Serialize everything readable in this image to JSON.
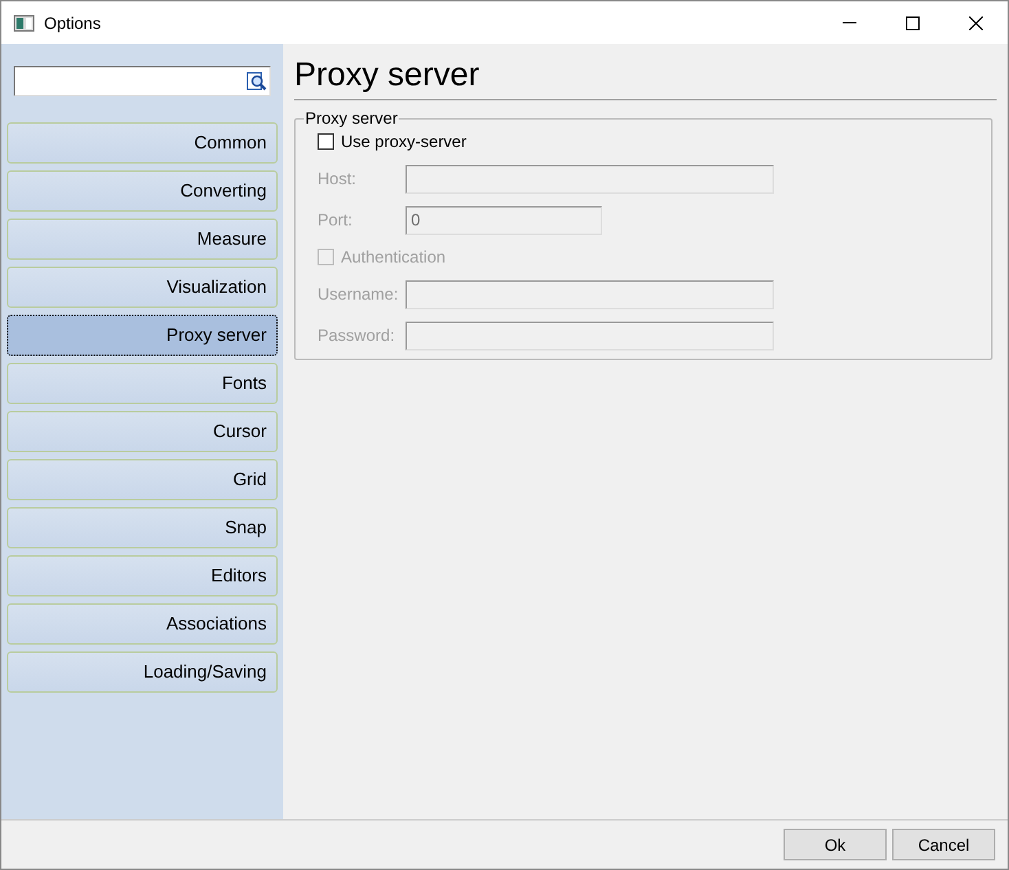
{
  "window": {
    "title": "Options"
  },
  "sidebar": {
    "items": [
      {
        "label": "Common",
        "selected": false
      },
      {
        "label": "Converting",
        "selected": false
      },
      {
        "label": "Measure",
        "selected": false
      },
      {
        "label": "Visualization",
        "selected": false
      },
      {
        "label": "Proxy server",
        "selected": true
      },
      {
        "label": "Fonts",
        "selected": false
      },
      {
        "label": "Cursor",
        "selected": false
      },
      {
        "label": "Grid",
        "selected": false
      },
      {
        "label": "Snap",
        "selected": false
      },
      {
        "label": "Editors",
        "selected": false
      },
      {
        "label": "Associations",
        "selected": false
      },
      {
        "label": "Loading/Saving",
        "selected": false
      }
    ]
  },
  "page": {
    "title": "Proxy server",
    "group": {
      "title": "Proxy server",
      "items": [
        {
          "kind": "checkbox",
          "label": "Use proxy-server",
          "checked": false,
          "disabled": false
        },
        {
          "kind": "field",
          "label": "Host:",
          "disabled": true
        },
        {
          "kind": "number",
          "label": "Port:",
          "value": "0",
          "disabled": true
        },
        {
          "kind": "checkbox",
          "label": "Authentication",
          "checked": false,
          "disabled": true
        },
        {
          "kind": "field",
          "label": "Username:",
          "disabled": true
        },
        {
          "kind": "field",
          "label": "Password:",
          "disabled": true
        }
      ]
    }
  },
  "buttons": [
    "Ok",
    "Cancel"
  ]
}
